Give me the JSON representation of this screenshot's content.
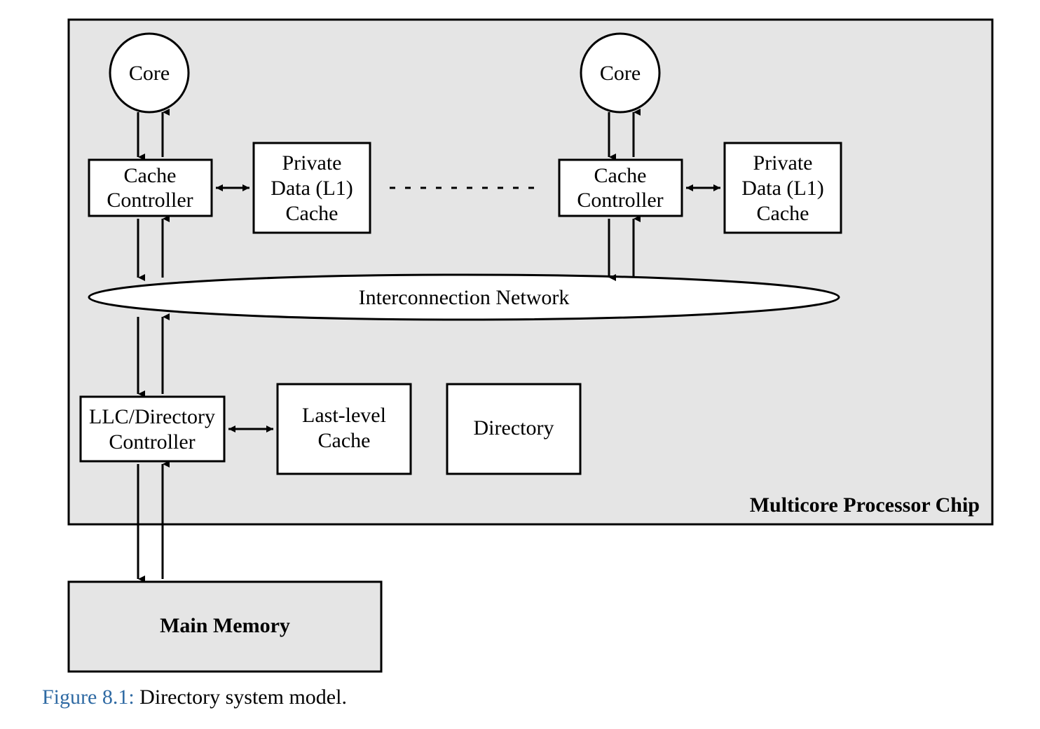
{
  "diagram": {
    "chip_label": "Multicore Processor Chip",
    "core_left": "Core",
    "core_right": "Core",
    "cache_ctrl_left_l1": "Cache",
    "cache_ctrl_left_l2": "Controller",
    "cache_ctrl_right_l1": "Cache",
    "cache_ctrl_right_l2": "Controller",
    "l1_left_l1": "Private",
    "l1_left_l2": "Data (L1)",
    "l1_left_l3": "Cache",
    "l1_right_l1": "Private",
    "l1_right_l2": "Data (L1)",
    "l1_right_l3": "Cache",
    "interconnect": "Interconnection Network",
    "llc_ctrl_l1": "LLC/Directory",
    "llc_ctrl_l2": "Controller",
    "llc_cache_l1": "Last-level",
    "llc_cache_l2": "Cache",
    "directory": "Directory",
    "main_memory": "Main Memory",
    "ellipsis_dashes": ""
  },
  "caption": {
    "fig_label": "Figure 8.1:",
    "text": " Directory system model."
  }
}
